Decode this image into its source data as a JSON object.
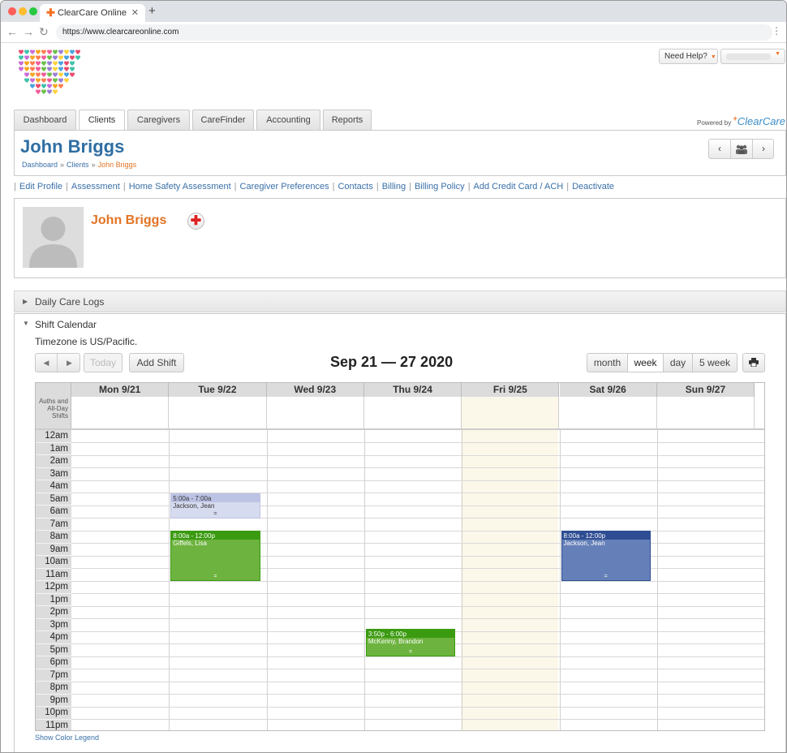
{
  "browser": {
    "tab_title": "ClearCare Online",
    "url": "https://www.clearcareonline.com",
    "new_tab": "+",
    "close": "✕"
  },
  "top": {
    "need_help": "Need Help?"
  },
  "tabs": [
    "Dashboard",
    "Clients",
    "Caregivers",
    "CareFinder",
    "Accounting",
    "Reports"
  ],
  "powered": {
    "prefix": "Powered by",
    "brand": "ClearCare"
  },
  "client": {
    "name": "John Briggs",
    "breadcrumb": [
      "Dashboard",
      "Clients",
      "John Briggs"
    ],
    "sep": "»"
  },
  "links": [
    "Edit Profile",
    "Assessment",
    "Home Safety Assessment",
    "Caregiver Preferences",
    "Contacts",
    "Billing",
    "Billing Policy",
    "Add Credit Card / ACH",
    "Deactivate"
  ],
  "sections": {
    "daily_logs": "Daily Care Logs",
    "shift_calendar": "Shift Calendar"
  },
  "calendar": {
    "timezone": "Timezone is US/Pacific.",
    "today_label": "Today",
    "add_shift": "Add Shift",
    "range_title": "Sep 21 — 27 2020",
    "views": [
      "month",
      "week",
      "day",
      "5 week"
    ],
    "active_view": "week",
    "days": [
      "Mon 9/21",
      "Tue 9/22",
      "Wed 9/23",
      "Thu 9/24",
      "Fri 9/25",
      "Sat 9/26",
      "Sun 9/27"
    ],
    "allday_label": "Auths and All-Day Shifts",
    "hours": [
      "12am",
      "1am",
      "2am",
      "3am",
      "4am",
      "5am",
      "6am",
      "7am",
      "8am",
      "9am",
      "10am",
      "11am",
      "12pm",
      "1pm",
      "2pm",
      "3pm",
      "4pm",
      "5pm",
      "6pm",
      "7pm",
      "8pm",
      "9pm",
      "10pm",
      "11pm"
    ],
    "events": [
      {
        "time": "5:00a - 7:00a",
        "name": "Jackson, Jean",
        "day": 1,
        "start": 5,
        "end": 7,
        "color": "#d7dbef",
        "head": "#bcc3e4",
        "text": "#333"
      },
      {
        "time": "8:00a - 12:00p",
        "name": "Giffels, Lisa",
        "day": 1,
        "start": 8,
        "end": 12,
        "color": "#6db33f",
        "head": "#3a9a10",
        "text": "#fff"
      },
      {
        "time": "3:50p - 6:00p",
        "name": "McKenny, Brandon",
        "day": 3,
        "start": 15.83,
        "end": 18,
        "color": "#6db33f",
        "head": "#3a9a10",
        "text": "#fff"
      },
      {
        "time": "8:00a - 12:00p",
        "name": "Jackson, Jean",
        "day": 5,
        "start": 8,
        "end": 12,
        "color": "#6580b8",
        "head": "#2f4d92",
        "text": "#fff"
      }
    ],
    "legend_link": "Show Color Legend",
    "grip": "="
  }
}
